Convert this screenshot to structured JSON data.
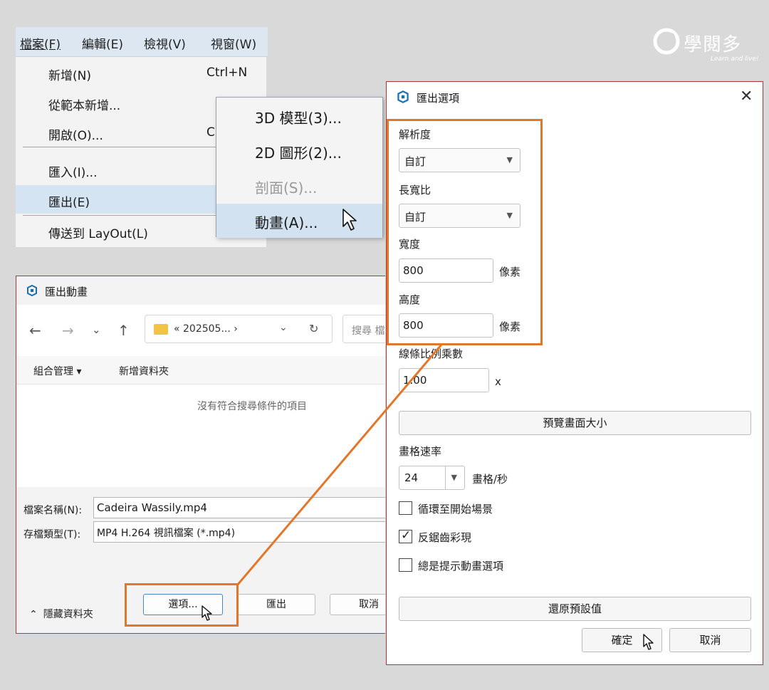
{
  "brand": {
    "name": "學閱多",
    "tagline": "Learn and live!"
  },
  "menubar": {
    "items": [
      "檔案(F)",
      "編輯(E)",
      "檢視(V)",
      "視窗(W)"
    ]
  },
  "file_menu": {
    "new": {
      "label": "新增(N)",
      "shortcut": "Ctrl+N"
    },
    "new_from_template": "從範本新增...",
    "open": {
      "label": "開啟(O)...",
      "shortcut": "C"
    },
    "import": "匯入(I)...",
    "export": "匯出(E)",
    "send_to_layout": "傳送到 LayOut(L)"
  },
  "export_submenu": {
    "model_3d": "3D 模型(3)...",
    "graphic_2d": "2D 圖形(2)...",
    "section": "剖面(S)...",
    "animation": "動畫(A)..."
  },
  "save_dialog": {
    "title": "匯出動畫",
    "path": "« 202505...  ›",
    "search_placeholder": "搜尋 檔",
    "organize": "組合管理 ▾",
    "new_folder": "新增資料夾",
    "empty_message": "沒有符合搜尋條件的項目",
    "filename_label": "檔案名稱(N):",
    "filename_value": "Cadeira Wassily.mp4",
    "filetype_label": "存檔類型(T):",
    "filetype_value": "MP4 H.264 視訊檔案 (*.mp4)",
    "hide_folders": "隱藏資料夾",
    "options_button": "選項...",
    "export_button": "匯出",
    "cancel_button": "取消"
  },
  "options_dialog": {
    "title": "匯出選項",
    "resolution_label": "解析度",
    "resolution_value": "自訂",
    "aspect_label": "長寬比",
    "aspect_value": "自訂",
    "width_label": "寬度",
    "width_value": "800",
    "height_label": "高度",
    "height_value": "800",
    "unit": "像素",
    "line_scale_label": "線條比例乘數",
    "line_scale_value": "1.00",
    "line_scale_unit": "x",
    "preview_button": "預覽畫面大小",
    "frame_rate_label": "畫格速率",
    "frame_rate_value": "24",
    "frame_rate_unit": "畫格/秒",
    "loop_label": "循環至開始場景",
    "loop_checked": false,
    "antialias_label": "反鋸齒彩現",
    "antialias_checked": true,
    "always_prompt_label": "總是提示動畫選項",
    "always_prompt_checked": false,
    "restore_button": "還原預設值",
    "ok_button": "確定",
    "cancel_button": "取消"
  },
  "colors": {
    "highlight": "#e2762a",
    "menu_hover": "#d5e4f3",
    "accent": "#4a86c8"
  }
}
